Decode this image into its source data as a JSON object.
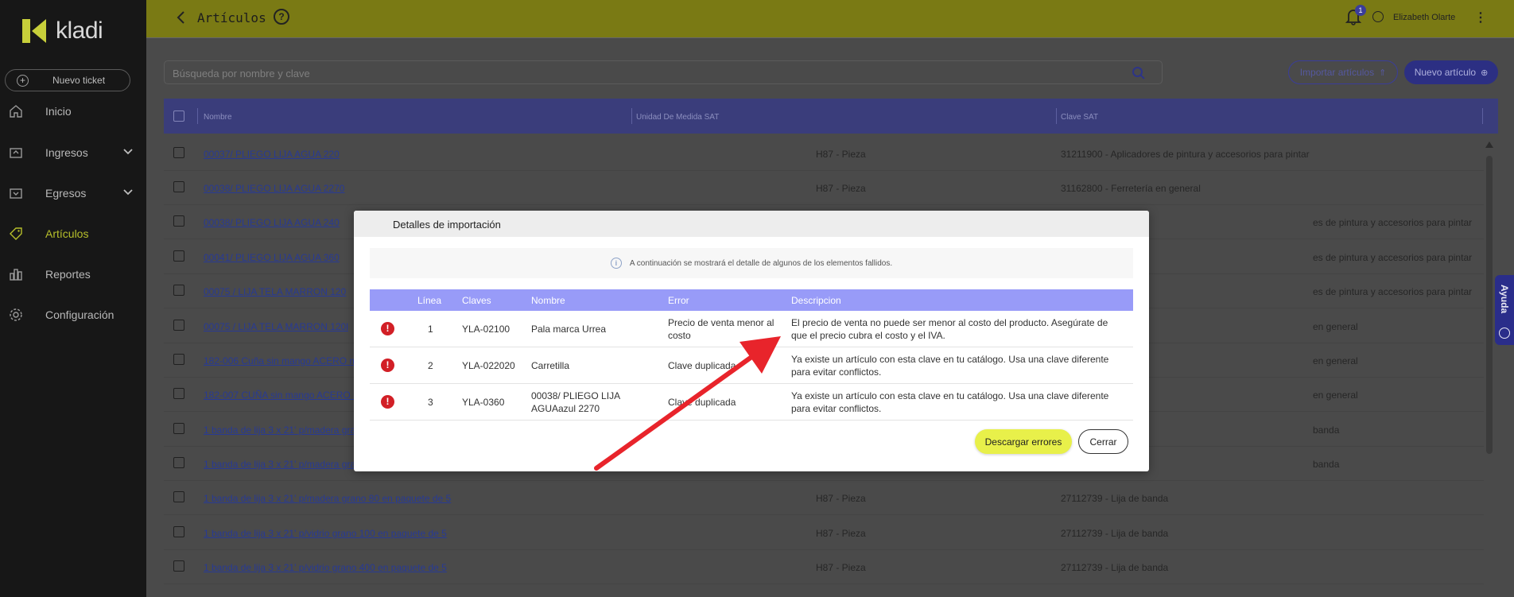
{
  "app": {
    "logo_text": "kladi",
    "new_ticket_label": "Nuevo ticket"
  },
  "sidebar": {
    "items": [
      {
        "label": "Inicio",
        "icon": "home-icon"
      },
      {
        "label": "Ingresos",
        "icon": "income-icon"
      },
      {
        "label": "Egresos",
        "icon": "expense-icon"
      },
      {
        "label": "Artículos",
        "icon": "tag-icon"
      },
      {
        "label": "Reportes",
        "icon": "reports-icon"
      },
      {
        "label": "Configuración",
        "icon": "gear-icon"
      }
    ]
  },
  "header": {
    "title": "Artículos",
    "notification_count": "1",
    "user_name": "Elizabeth Olarte"
  },
  "search": {
    "placeholder": "Búsqueda por nombre y clave"
  },
  "actions": {
    "import_label": "Importar artículos",
    "new_label": "Nuevo artículo"
  },
  "table": {
    "headers": [
      "Nombre",
      "Unidad De Medida SAT",
      "Clave SAT"
    ],
    "rows": [
      {
        "name": "00037/ PLIEGO LIJA AGUA 220",
        "unit": "H87 - Pieza",
        "clave": "31211900 - Aplicadores de pintura y accesorios para pintar"
      },
      {
        "name": "00038/ PLIEGO LIJA AGUA 2270",
        "unit": "H87 - Pieza",
        "clave": "31162800 - Ferretería en general"
      },
      {
        "name": "00038/ PLIEGO LIJA AGUA 240",
        "unit": "",
        "clave": "es de pintura y accesorios para pintar"
      },
      {
        "name": "00041/ PLIEGO LIJA AGUA 360",
        "unit": "",
        "clave": "es de pintura y accesorios para pintar"
      },
      {
        "name": "00075 / LIJA TELA MARRON 120",
        "unit": "",
        "clave": "es de pintura y accesorios para pintar"
      },
      {
        "name": "00075 / LIJA TELA MARRON 120l",
        "unit": "",
        "clave": "en general"
      },
      {
        "name": "182-006 Cuña sin mango ACERO m",
        "unit": "",
        "clave": "en general"
      },
      {
        "name": "182-007 CUÑA sin mango ACERO D",
        "unit": "",
        "clave": "en general"
      },
      {
        "name": "1 banda de lija 3 x 21' p/madera gra",
        "unit": "",
        "clave": "banda"
      },
      {
        "name": "1 banda de lija 3 x 21' p/madera gra",
        "unit": "",
        "clave": "banda"
      },
      {
        "name": "1 banda de lija 3 x 21' p/madera grano 80 en paquete de 5",
        "unit": "H87 - Pieza",
        "clave": "27112739 - Lija de banda"
      },
      {
        "name": "1 banda de lija 3 x 21' p/vidrio grano 100 en paquete de 5",
        "unit": "H87 - Pieza",
        "clave": "27112739 - Lija de banda"
      },
      {
        "name": "1 banda de lija 3 x 21' p/vidrio grano 400 en paquete de 5",
        "unit": "H87 - Pieza",
        "clave": "27112739 - Lija de banda"
      }
    ]
  },
  "help_tab": {
    "label": "Ayuda"
  },
  "modal": {
    "title": "Detalles de importación",
    "info": "A continuación se mostrará el detalle de algunos de los elementos fallidos.",
    "headers": {
      "line": "Línea",
      "keys": "Claves",
      "name": "Nombre",
      "error": "Error",
      "description": "Descripcion"
    },
    "rows": [
      {
        "line": "1",
        "keys": "YLA-02100",
        "name": "Pala marca Urrea",
        "error": "Precio de venta menor al costo",
        "description": "El precio de venta no puede ser menor al costo del producto. Asegúrate de que el precio cubra el costo y el IVA."
      },
      {
        "line": "2",
        "keys": "YLA-022020",
        "name": "Carretilla",
        "error": "Clave duplicada",
        "description": "Ya existe un artículo con esta clave en tu catálogo. Usa una clave diferente para evitar conflictos."
      },
      {
        "line": "3",
        "keys": "YLA-0360",
        "name": "00038/ PLIEGO LIJA AGUAazul 2270",
        "error": "Clave duplicada",
        "description": "Ya existe un artículo con esta clave en tu catálogo. Usa una clave diferente para evitar conflictos."
      }
    ],
    "download_label": "Descargar errores",
    "close_label": "Cerrar"
  },
  "colors": {
    "accent_yellow": "#e8f04a",
    "primary_indigo": "#2c2f83",
    "error_red": "#d21f26",
    "annotation_arrow": "#e8242b"
  }
}
